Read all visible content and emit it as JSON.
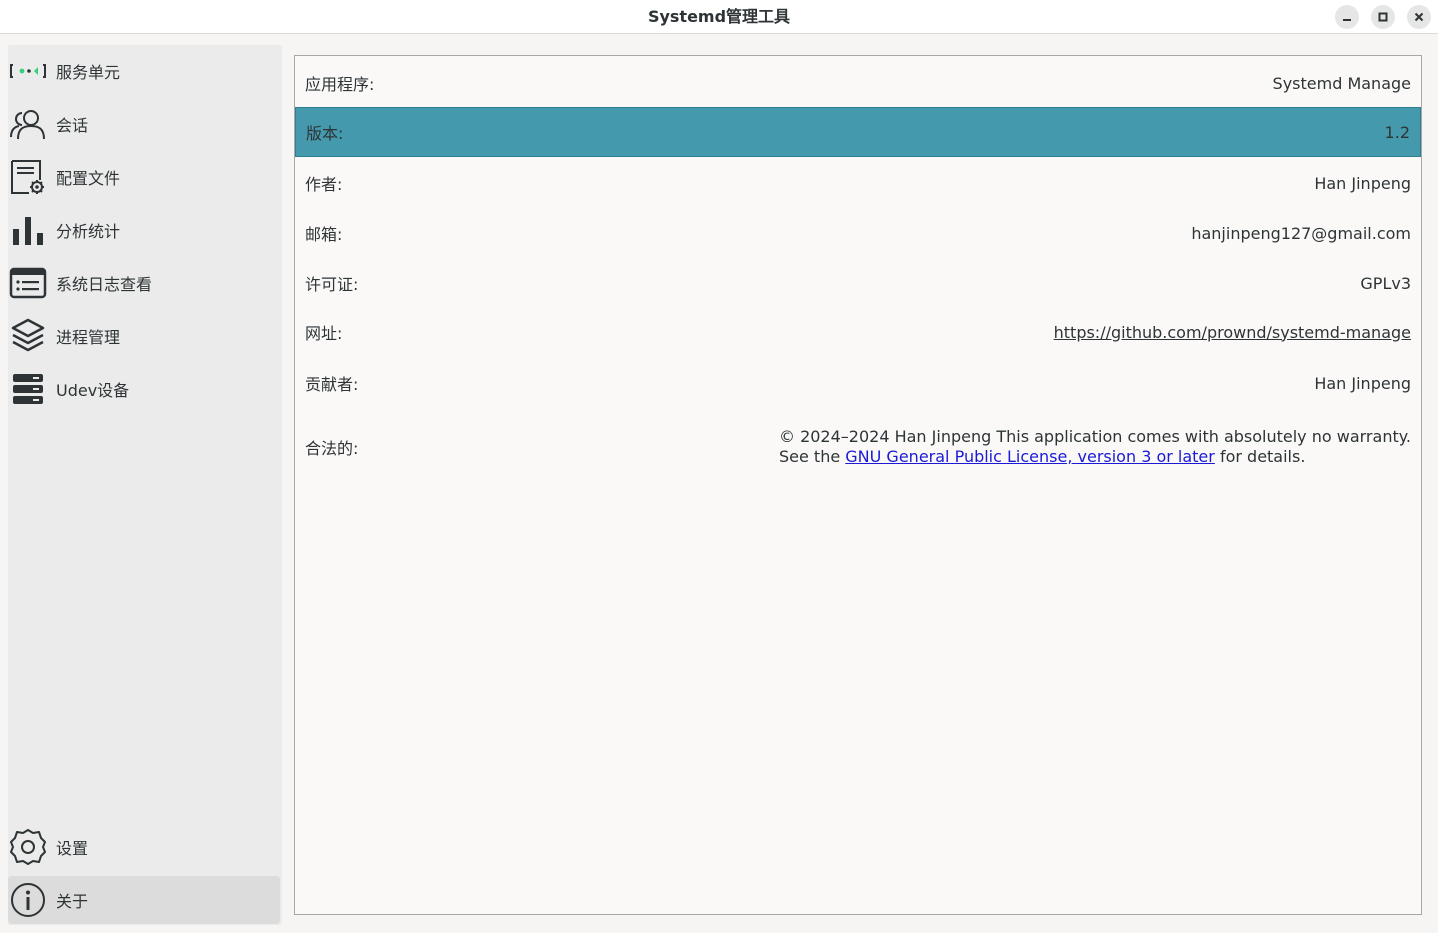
{
  "window": {
    "title": "Systemd管理工具"
  },
  "sidebar": {
    "items": [
      {
        "label": "服务单元",
        "icon": "service-units-icon"
      },
      {
        "label": "会话",
        "icon": "sessions-icon"
      },
      {
        "label": "配置文件",
        "icon": "config-file-icon"
      },
      {
        "label": "分析统计",
        "icon": "bar-chart-icon"
      },
      {
        "label": "系统日志查看",
        "icon": "log-viewer-icon"
      },
      {
        "label": "进程管理",
        "icon": "layers-icon"
      },
      {
        "label": "Udev设备",
        "icon": "server-icon"
      }
    ],
    "bottom": [
      {
        "label": "设置",
        "icon": "gear-icon"
      },
      {
        "label": "关于",
        "icon": "info-icon"
      }
    ]
  },
  "about": {
    "rows": [
      {
        "key": "应用程序:",
        "value": "Systemd Manage"
      },
      {
        "key": "版本:",
        "value": "1.2"
      },
      {
        "key": "作者:",
        "value": "Han Jinpeng"
      },
      {
        "key": "邮箱:",
        "value": "hanjinpeng127@gmail.com"
      },
      {
        "key": "许可证:",
        "value": "GPLv3"
      },
      {
        "key": "网址:",
        "value": "https://github.com/prownd/systemd-manage"
      },
      {
        "key": "贡献者:",
        "value": "Han Jinpeng"
      }
    ],
    "legal": {
      "key": "合法的:",
      "line1": "© 2024–2024 Han Jinpeng This application comes with absolutely no warranty.",
      "line2_prefix": "See the ",
      "link_text": "GNU General Public License, version 3 or later",
      "line2_suffix": " for details."
    }
  },
  "colors": {
    "selected_row": "#4599ad",
    "link": "#1a1ad6",
    "service_dot": "#33d17a"
  }
}
